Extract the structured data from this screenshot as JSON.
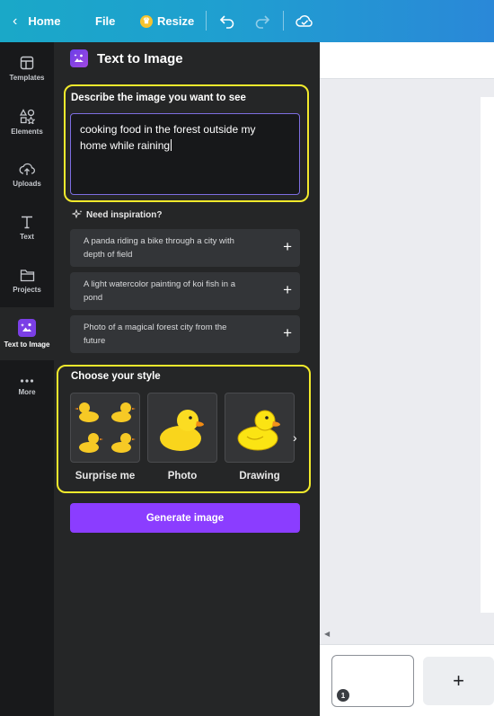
{
  "topbar": {
    "home_label": "Home",
    "file_label": "File",
    "resize_label": "Resize",
    "gradient_colors": [
      "#1aa8c8",
      "#2a88d8"
    ]
  },
  "rail": {
    "items": [
      {
        "label": "Templates",
        "icon": "templates-icon"
      },
      {
        "label": "Elements",
        "icon": "elements-icon"
      },
      {
        "label": "Uploads",
        "icon": "upload-icon"
      },
      {
        "label": "Text",
        "icon": "text-icon"
      },
      {
        "label": "Projects",
        "icon": "folder-icon"
      },
      {
        "label": "Text to Image",
        "icon": "text-to-image-icon",
        "active": true
      },
      {
        "label": "More",
        "icon": "more-icon"
      }
    ]
  },
  "panel": {
    "title": "Text to Image",
    "describe_label": "Describe the image you want to see",
    "prompt_line1": "cooking food in the forest outside my",
    "prompt_line2": "home while raining",
    "inspiration_label": "Need inspiration?",
    "suggestions": [
      {
        "line1": "A panda riding a bike through a city with",
        "line2": "depth of field"
      },
      {
        "line1": "A light watercolor painting of koi fish in a",
        "line2": "pond"
      },
      {
        "line1": "Photo of a magical forest city from the",
        "line2": "future"
      }
    ],
    "style_label": "Choose your style",
    "styles": [
      "Surprise me",
      "Photo",
      "Drawing"
    ],
    "generate_label": "Generate image",
    "accent_color": "#8b3dff",
    "highlight_color": "#f2ea2c"
  },
  "thumbstrip": {
    "page_number": "1",
    "add_label": "+"
  }
}
